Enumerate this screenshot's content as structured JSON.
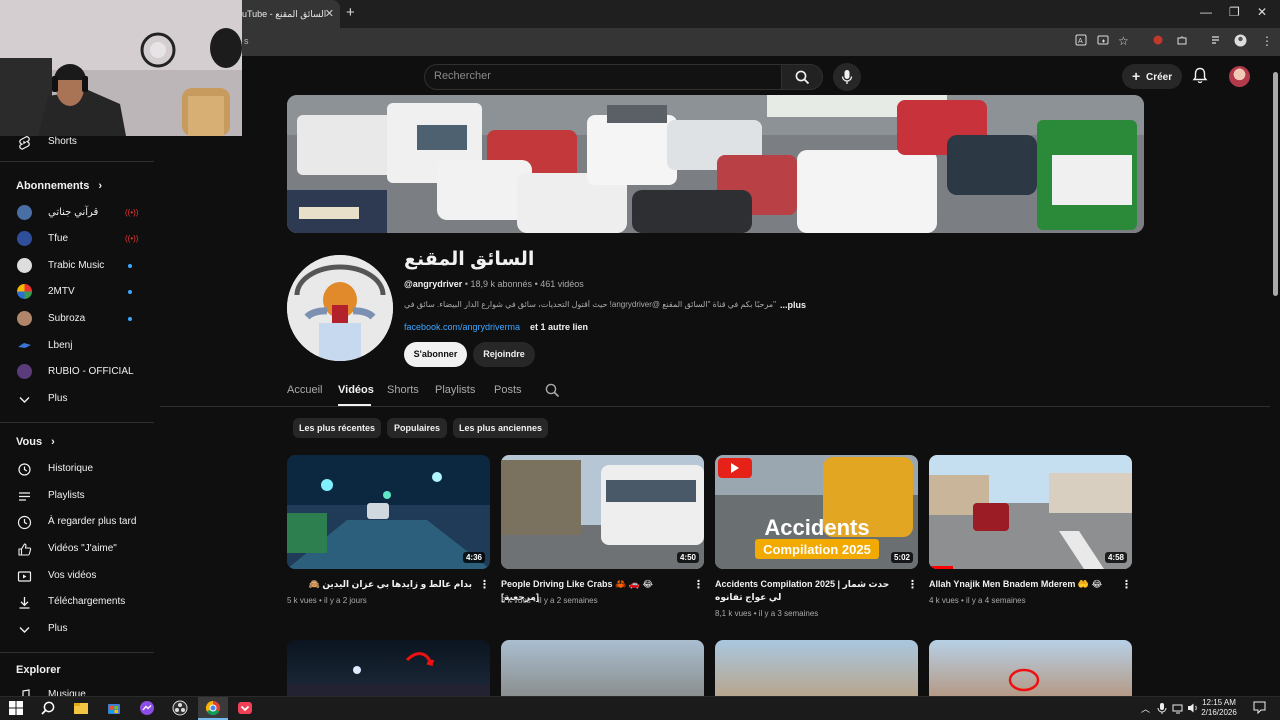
{
  "browser": {
    "tab_title": "(32) السائق المقنع - YouTube",
    "tab_title_visible": "uTube - السائق المقنع",
    "address_fragment": "s"
  },
  "youtube_header": {
    "search_placeholder": "Rechercher",
    "create_label": "Créer"
  },
  "sidebar": {
    "shorts_label": "Shorts",
    "subscriptions_heading": "Abonnements",
    "subscriptions": [
      {
        "label": "قرآني جناتي",
        "color": "#4a6fa5",
        "badge": "live"
      },
      {
        "label": "Tfue",
        "color": "#2f4f9a",
        "badge": "live"
      },
      {
        "label": "Trabic Music",
        "color": "#dddddd",
        "badge": "dot"
      },
      {
        "label": "2MTV",
        "color": "#3a9c4f",
        "badge": "dot"
      },
      {
        "label": "Subroza",
        "color": "#b0856a",
        "badge": "dot"
      },
      {
        "label": "Lbenj",
        "color": "#2a4f8c",
        "badge": "none"
      },
      {
        "label": "RUBIO - OFFICIAL",
        "color": "#5a3c7a",
        "badge": "none"
      }
    ],
    "subs_more": "Plus",
    "you_heading": "Vous",
    "you_items": [
      {
        "label": "Historique",
        "icon": "history-icon"
      },
      {
        "label": "Playlists",
        "icon": "playlists-icon"
      },
      {
        "label": "À regarder plus tard",
        "icon": "watch-later-icon"
      },
      {
        "label": "Vidéos \"J'aime\"",
        "icon": "thumbs-up-icon"
      },
      {
        "label": "Vos vidéos",
        "icon": "your-videos-icon"
      },
      {
        "label": "Téléchargements",
        "icon": "download-icon"
      }
    ],
    "you_more": "Plus",
    "explore_heading": "Explorer",
    "explore_first": "Musique"
  },
  "channel": {
    "name": "السائق المقنع",
    "handle": "@angrydriver",
    "subscribers": "18,9 k abonnés",
    "videos_count": "461 vidéos",
    "description": "\"مرحبًا بكم في قناة \"السائق المقنع @angrydriver! حيث أقتول التحديات، سائق في شوارع الدار البيضاء. سائق في رحلتي ك",
    "description_more": "...plus",
    "link_text": "facebook.com/angrydriverma",
    "link_more": "et 1 autre lien",
    "subscribe_label": "S'abonner",
    "join_label": "Rejoindre"
  },
  "channel_tabs": [
    "Accueil",
    "Vidéos",
    "Shorts",
    "Playlists",
    "Posts"
  ],
  "active_tab": "Vidéos",
  "chips": [
    "Les plus récentes",
    "Populaires",
    "Les plus anciennes"
  ],
  "videos": [
    {
      "title": "بدام عالط و زايدها بي عزان اليدين 🙈",
      "views": "5 k vues",
      "age": "il y a 2 jours",
      "duration": "4:36",
      "watched_fraction": 0.0
    },
    {
      "title": "People Driving Like Crabs 🦀 🚗 😂 [مرجعية]",
      "views": "5 k vues",
      "age": "il y a 2 semaines",
      "duration": "4:50",
      "watched_fraction": 0.0
    },
    {
      "title": "Accidents Compilation 2025 | حدث شمار لي عواج تفانوه",
      "views": "8,1 k vues",
      "age": "il y a 3 semaines",
      "duration": "5:02",
      "watched_fraction": 0.0,
      "thumb_text_1": "Accidents",
      "thumb_text_2": "Compilation 2025"
    },
    {
      "title": "Allah Ynajik Men Bnadem Mderem 🤲 😂",
      "views": "4 k vues",
      "age": "il y a 4 semaines",
      "duration": "4:58",
      "watched_fraction": 0.12
    }
  ],
  "taskbar": {
    "time": "12:15 AM",
    "date": "2/16/2026"
  },
  "colors": {
    "background": "#0f0f0f",
    "accent_red": "#ff0000",
    "link_blue": "#3ea6ff",
    "chip_bg": "#272727"
  }
}
